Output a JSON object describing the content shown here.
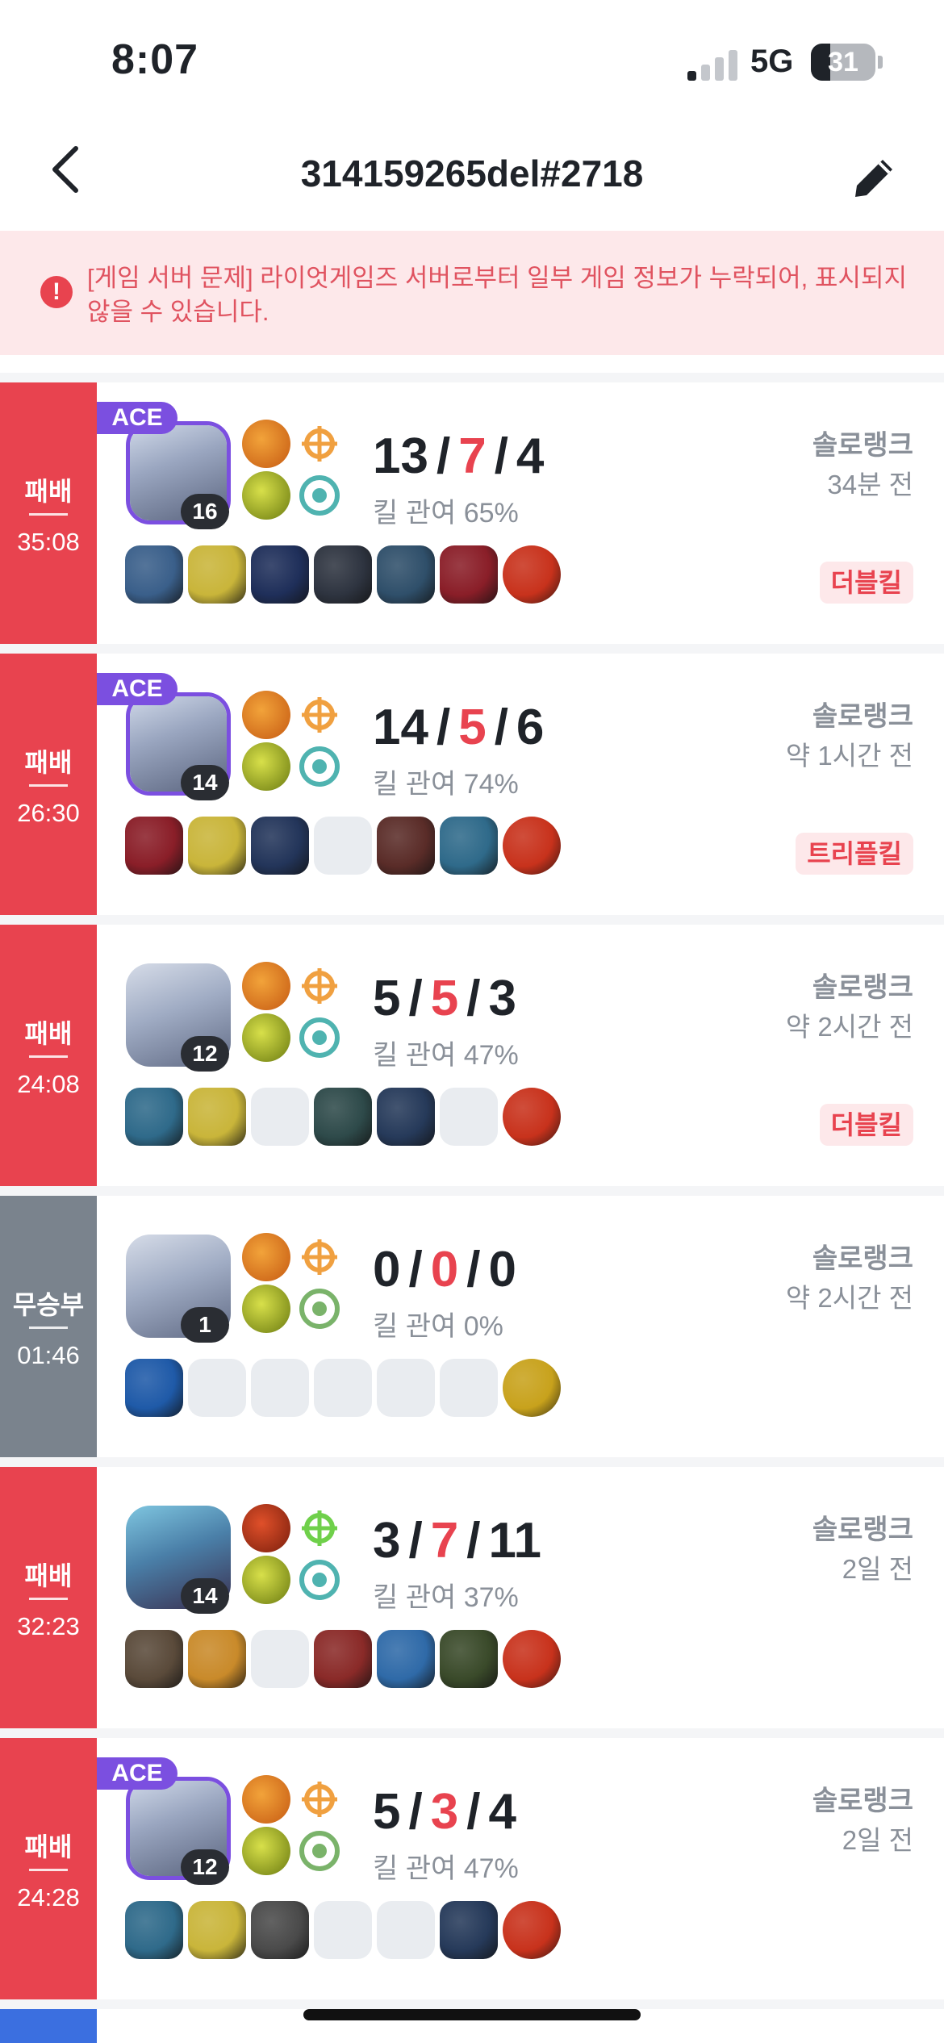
{
  "status_bar": {
    "time": "8:07",
    "network": "5G",
    "battery": "31"
  },
  "nav": {
    "title": "314159265del#2718"
  },
  "warning": {
    "text": "[게임 서버 문제] 라이엇게임즈 서버로부터 일부 게임 정보가 누락되어, 표시되지 않을 수 있습니다."
  },
  "colors": {
    "loss": "#e8434f",
    "remake": "#7a838d",
    "ace": "#7b4fe0",
    "text_muted": "#8a9099"
  },
  "matches": [
    {
      "result": "패배",
      "duration": "35:08",
      "ace": "ACE",
      "level": "16",
      "kills": "13",
      "deaths": "7",
      "assists": "4",
      "kp": "킬 관여 65%",
      "queue": "솔로랭크",
      "ago": "34분 전",
      "multikill": "더블킬"
    },
    {
      "result": "패배",
      "duration": "26:30",
      "ace": "ACE",
      "level": "14",
      "kills": "14",
      "deaths": "5",
      "assists": "6",
      "kp": "킬 관여 74%",
      "queue": "솔로랭크",
      "ago": "약 1시간 전",
      "multikill": "트리플킬"
    },
    {
      "result": "패배",
      "duration": "24:08",
      "ace": "",
      "level": "12",
      "kills": "5",
      "deaths": "5",
      "assists": "3",
      "kp": "킬 관여 47%",
      "queue": "솔로랭크",
      "ago": "약 2시간 전",
      "multikill": "더블킬"
    },
    {
      "result": "무승부",
      "duration": "01:46",
      "ace": "",
      "level": "1",
      "kills": "0",
      "deaths": "0",
      "assists": "0",
      "kp": "킬 관여 0%",
      "queue": "솔로랭크",
      "ago": "약 2시간 전",
      "multikill": ""
    },
    {
      "result": "패배",
      "duration": "32:23",
      "ace": "",
      "level": "14",
      "kills": "3",
      "deaths": "7",
      "assists": "11",
      "kp": "킬 관여 37%",
      "queue": "솔로랭크",
      "ago": "2일 전",
      "multikill": ""
    },
    {
      "result": "패배",
      "duration": "24:28",
      "ace": "ACE",
      "level": "12",
      "kills": "5",
      "deaths": "3",
      "assists": "4",
      "kp": "킬 관여 47%",
      "queue": "솔로랭크",
      "ago": "2일 전",
      "multikill": ""
    }
  ]
}
